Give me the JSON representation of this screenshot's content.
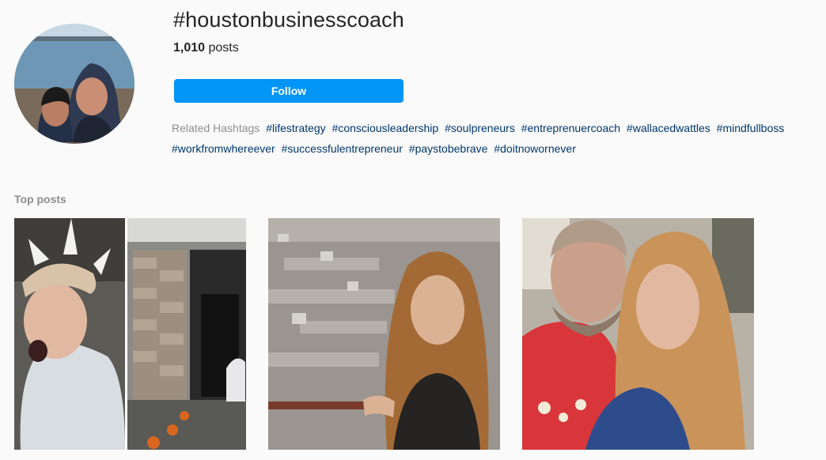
{
  "header": {
    "hashtag": "#houstonbusinesscoach",
    "post_count": "1,010",
    "post_label": "posts",
    "follow_label": "Follow"
  },
  "related": {
    "label": "Related Hashtags",
    "tags": [
      "#lifestrategy",
      "#consciousleadership",
      "#soulpreneurs",
      "#entreprenuercoach",
      "#wallacedwattles",
      "#mindfullboss",
      "#workfromwhereever",
      "#successfulentrepreneur",
      "#paystobebrave",
      "#doitnowornever"
    ]
  },
  "top_posts": {
    "heading": "Top posts"
  },
  "colors": {
    "accent": "#0095f6",
    "hashtag_link": "#00376b",
    "muted": "#8e8e8e",
    "background": "#fafafa"
  }
}
